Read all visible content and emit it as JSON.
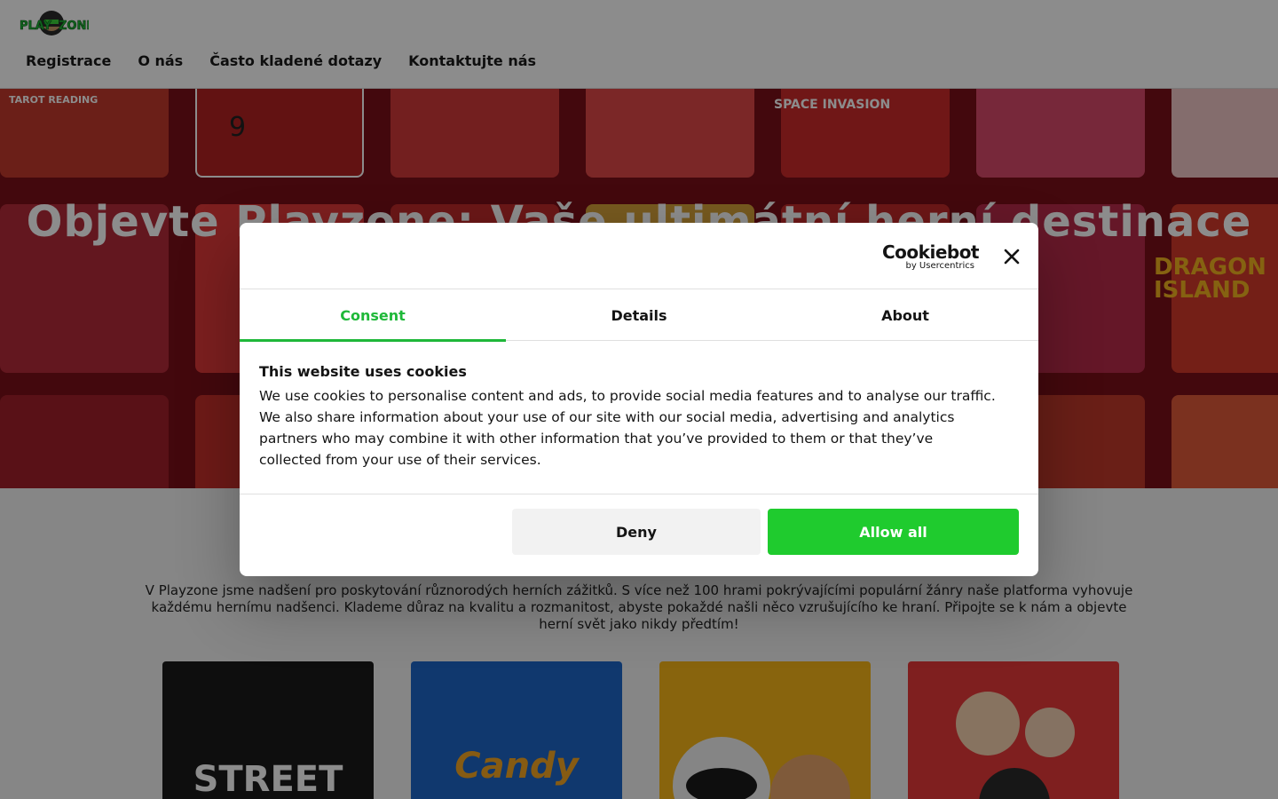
{
  "header": {
    "logo_text": "PLAYZONE",
    "nav": [
      {
        "label": "Registrace"
      },
      {
        "label": "O nás"
      },
      {
        "label": "Často kladené dotazy"
      },
      {
        "label": "Kontaktujte nás"
      }
    ]
  },
  "hero": {
    "title": "Objevte Playzone: Vaše ultimátní herní destinace",
    "tile_texts": [
      "TAROT READING",
      "9",
      "SPACE INVASION",
      "DRAGON ISLAND"
    ]
  },
  "main": {
    "intro": "V Playzone jsme nadšení pro poskytování různorodých herních zážitků. S více než 100 hrami pokrývajícími populární žánry naše platforma vyhovuje každému hernímu nadšenci. Klademe důraz na kvalitu a rozmanitost, abyste pokaždé našli něco vzrušujícího ke hraní. Připojte se k nám a objevte herní svět jako nikdy předtím!",
    "card_texts": [
      "STREET",
      "Candy"
    ]
  },
  "cookie_dialog": {
    "brand_main": "Cookiebot",
    "brand_sub": "by Usercentrics",
    "tabs": [
      {
        "label": "Consent"
      },
      {
        "label": "Details"
      },
      {
        "label": "About"
      }
    ],
    "heading": "This website uses cookies",
    "body": "We use cookies to personalise content and ads, to provide social media features and to analyse our traffic. We also share information about your use of our site with our social media, advertising and analytics partners who may combine it with other information that you’ve provided to them or that they’ve collected from your use of their services.",
    "deny_label": "Deny",
    "allow_label": "Allow all",
    "accent_color": "#1fcb2e"
  }
}
